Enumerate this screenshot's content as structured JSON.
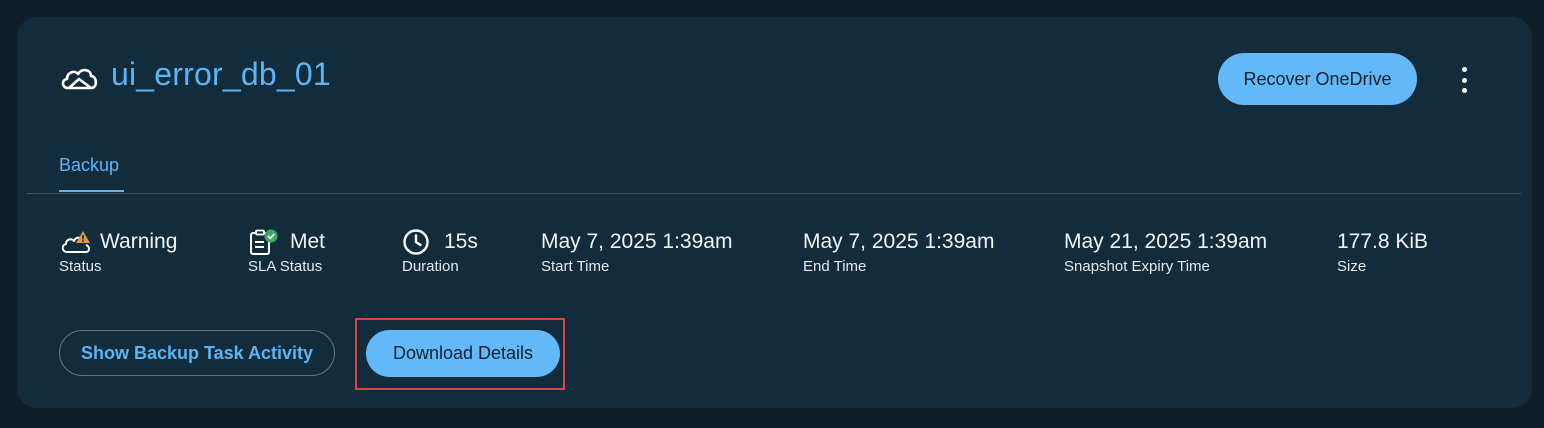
{
  "header": {
    "icon": "onedrive-cloud-icon",
    "title": "ui_error_db_01",
    "recover_button": "Recover OneDrive",
    "menu_icon": "more-vertical-icon"
  },
  "tabs": [
    {
      "label": "Backup",
      "active": true
    }
  ],
  "stats": [
    {
      "icon": "cloud-warning-icon",
      "value": "Warning",
      "label": "Status"
    },
    {
      "icon": "clipboard-check-icon",
      "value": "Met",
      "label": "SLA Status"
    },
    {
      "icon": "clock-icon",
      "value": "15s",
      "label": "Duration"
    },
    {
      "value": "May 7, 2025 1:39am",
      "label": "Start Time"
    },
    {
      "value": "May 7, 2025 1:39am",
      "label": "End Time"
    },
    {
      "value": "May 21, 2025 1:39am",
      "label": "Snapshot Expiry Time"
    },
    {
      "value": "177.8 KiB",
      "label": "Size"
    }
  ],
  "actions": {
    "show_activity": "Show Backup Task Activity",
    "download": "Download Details"
  },
  "colors": {
    "accent": "#5cb4f5",
    "button_fill": "#63b8f7",
    "card_bg": "#132c3c",
    "highlight": "#e04545",
    "warning": "#e29a3a",
    "success": "#3fa66a"
  }
}
